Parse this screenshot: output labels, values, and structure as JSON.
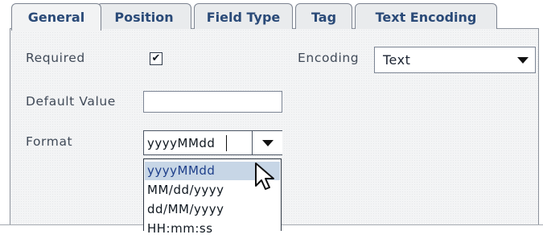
{
  "tabs": [
    {
      "label": "General",
      "active": true
    },
    {
      "label": "Position",
      "active": false
    },
    {
      "label": "Field Type",
      "active": false
    },
    {
      "label": "Tag",
      "active": false
    },
    {
      "label": "Text Encoding",
      "active": false
    }
  ],
  "form": {
    "required_label": "Required",
    "required_checked": true,
    "required_mark": "✔",
    "encoding_label": "Encoding",
    "encoding_value": "Text",
    "default_value_label": "Default Value",
    "default_value": "",
    "format_label": "Format",
    "format_value": "yyyyMMdd",
    "format_options": [
      "yyyyMMdd",
      "MM/dd/yyyy",
      "dd/MM/yyyy",
      "HH:mm:ss"
    ],
    "format_selected_index": 0
  },
  "icons": {
    "dropdown_arrow": "chevron-down-icon",
    "cursor": "mouse-pointer-icon"
  },
  "colors": {
    "tab_text": "#2a4a78",
    "selected_option_bg": "#c7d6e6"
  }
}
